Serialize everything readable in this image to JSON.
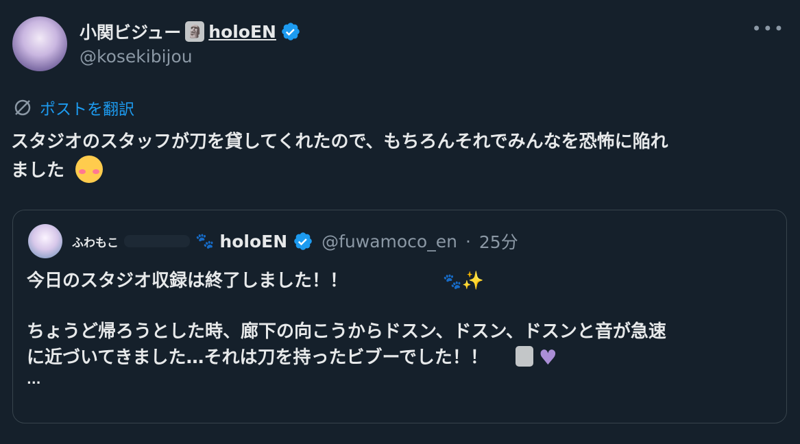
{
  "author": {
    "display_name": "小関ビジュー",
    "affiliation": "holoEN",
    "handle": "@kosekibijou"
  },
  "more_menu": "•••",
  "translate_label": "ポストを翻訳",
  "post": {
    "line1": "スタジオのスタッフが刀を貸してくれたので、もちろんそれでみんなを恐怖に陥れ",
    "line2": "ました"
  },
  "quote": {
    "author_name": "ふわもこ",
    "affiliation": "holoEN",
    "handle": "@fuwamoco_en",
    "separator": " · ",
    "time": "25分",
    "line1": "今日のスタジオ収録は終了しました！！",
    "line2": "ちょうど帰ろうとした時、廊下の向こうからドスン、ドスン、ドスンと音が急速",
    "line3": "に近づいてきました…それは刀を持ったビブーでした！！",
    "ellipsis": "..."
  },
  "colors": {
    "background": "#15202b",
    "accent": "#1d9bf0",
    "muted": "#8b98a5",
    "border": "#38444d"
  }
}
